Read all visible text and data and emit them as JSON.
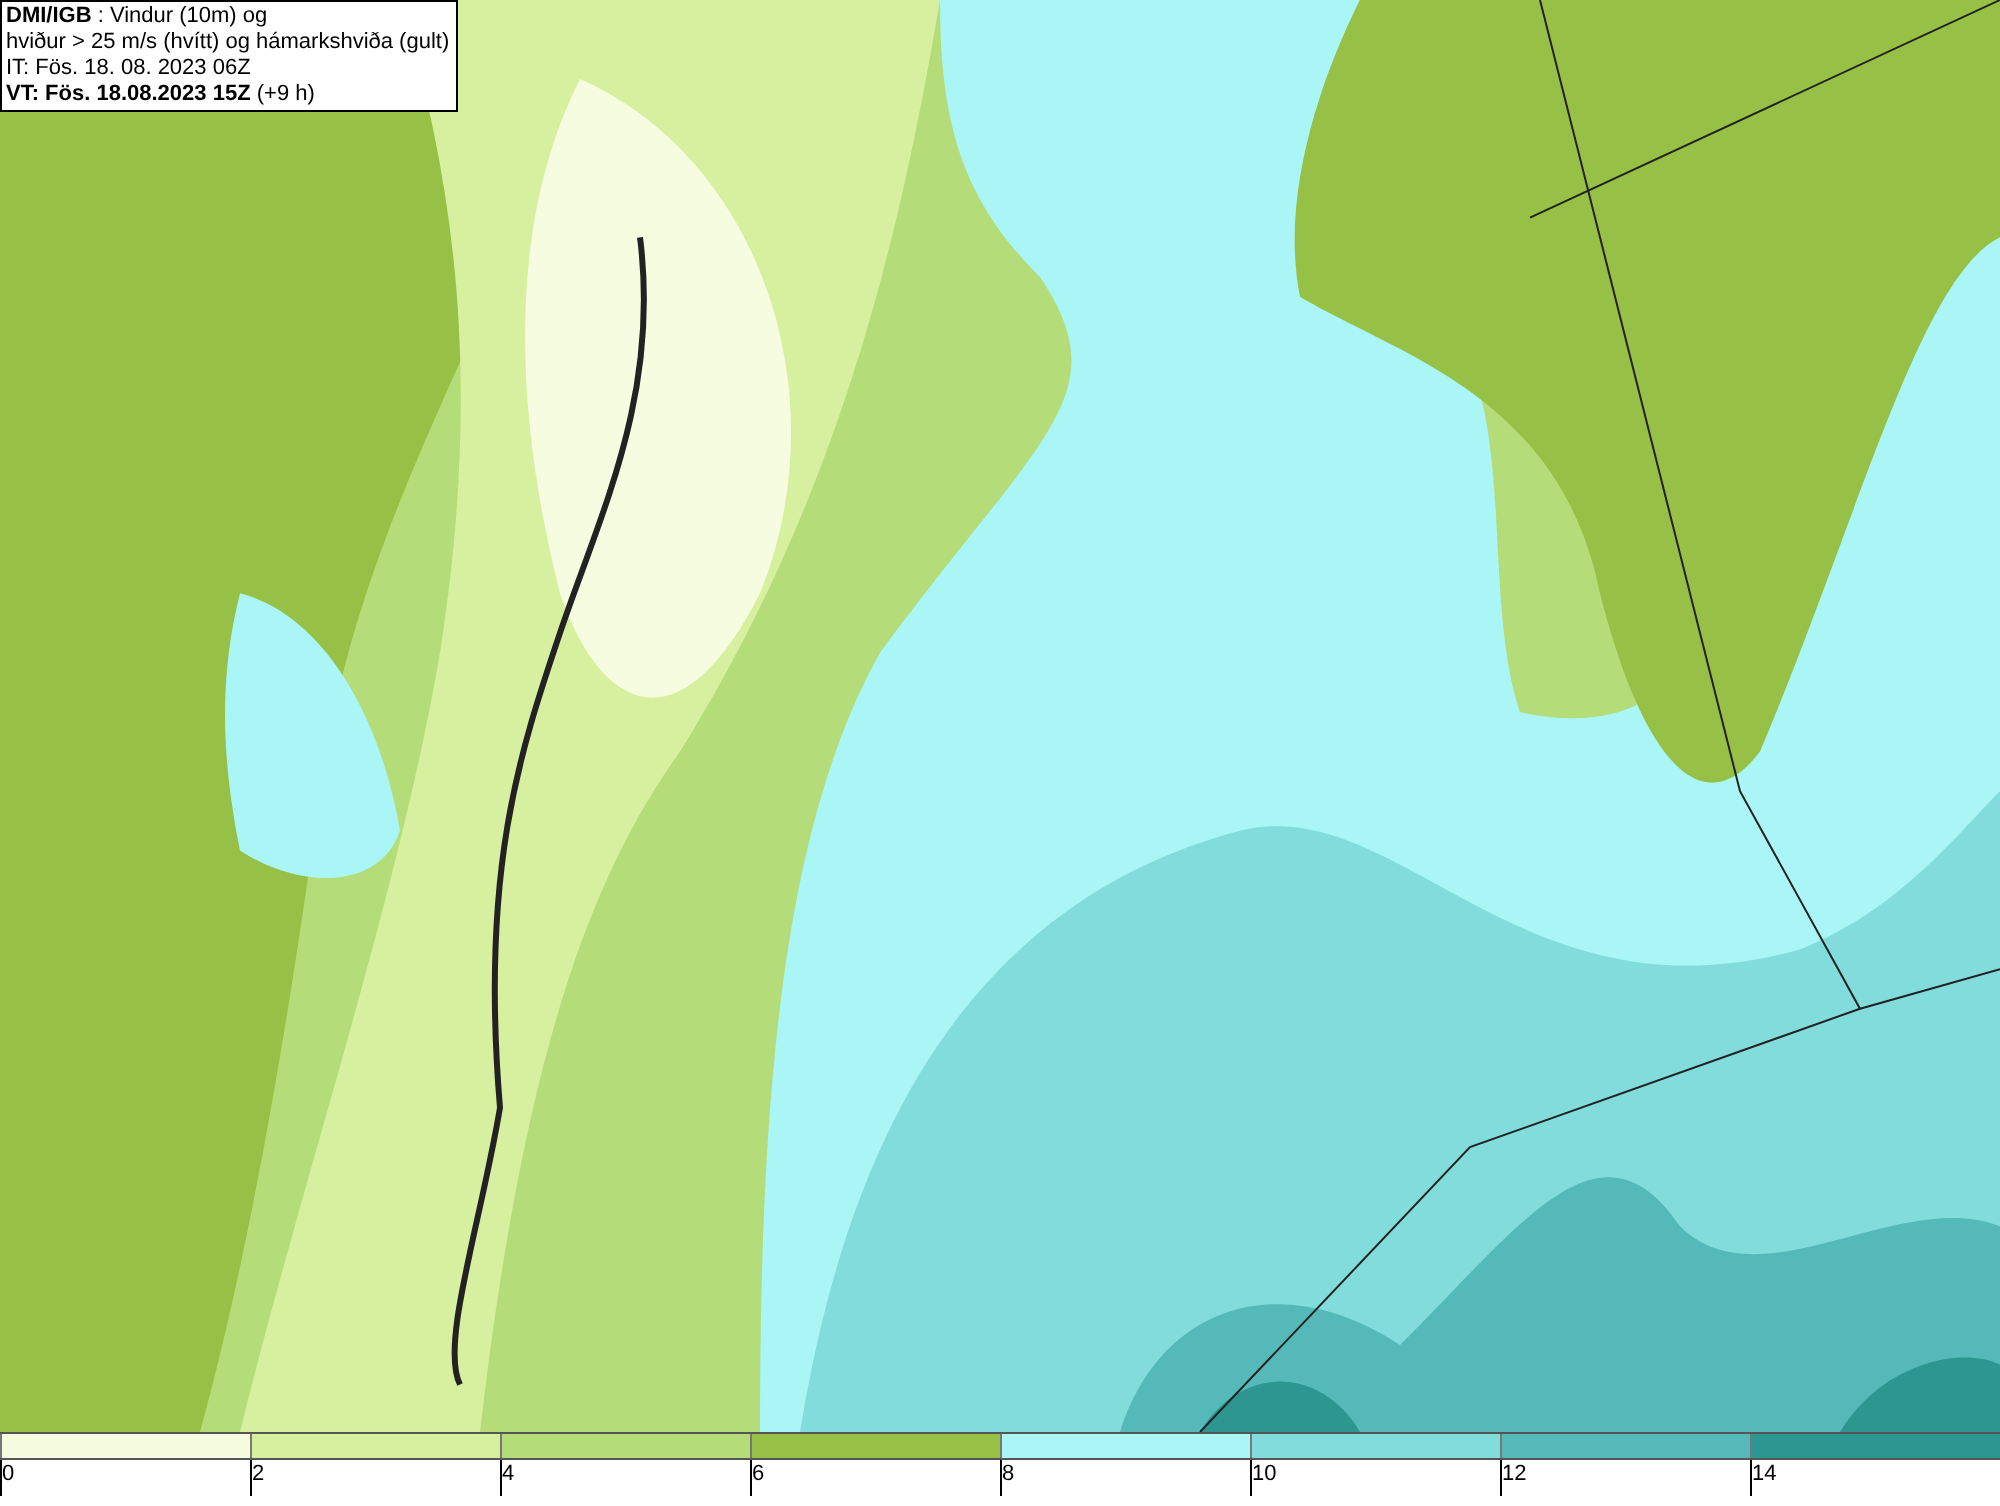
{
  "title_box": {
    "lines": [
      "**DMI/IGB** : Vindur (10m) og",
      "hviður > 25 m/s (hvítt) og hámarkshviða (gult)",
      "IT: Fös. 18. 08. 2023 06Z",
      "**VT: Fös. 18.08.2023 15Z** (+9 h)"
    ]
  },
  "legend": [
    {
      "label": "0",
      "color": "#f5fce0"
    },
    {
      "label": "2",
      "color": "#d7f0a0"
    },
    {
      "label": "4",
      "color": "#b4dc78"
    },
    {
      "label": "6",
      "color": "#96c046"
    },
    {
      "label": "8",
      "color": "#aaf5f5"
    },
    {
      "label": "10",
      "color": "#82dcdc"
    },
    {
      "label": "12",
      "color": "#55b9b9"
    },
    {
      "label": "14",
      "color": "#2d9691"
    }
  ]
}
